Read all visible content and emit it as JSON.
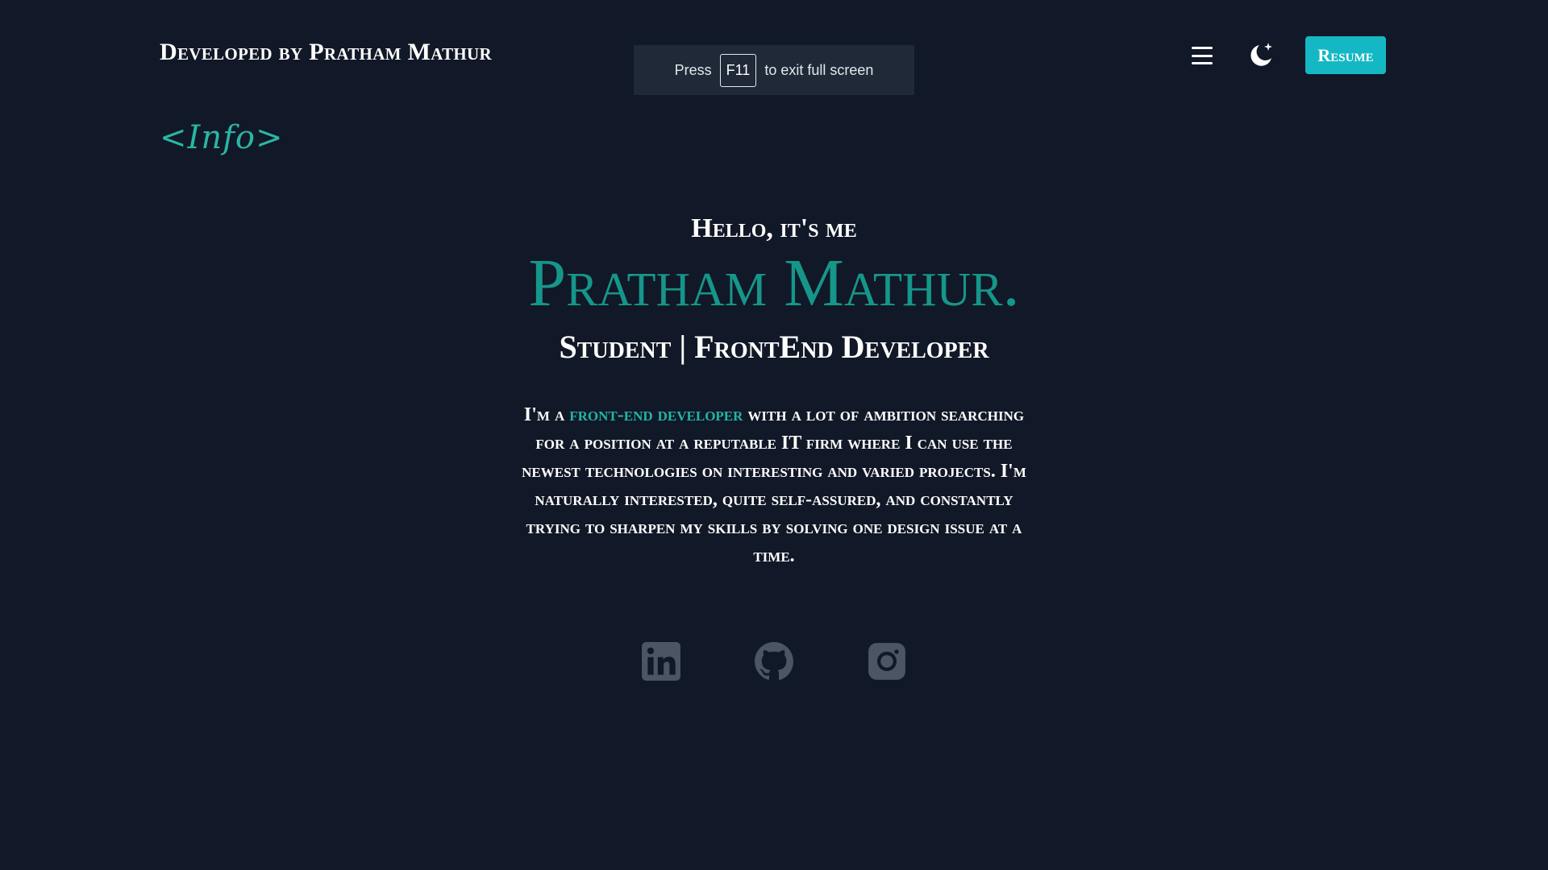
{
  "header": {
    "brand": "Developed by Pratham Mathur",
    "resume_label": "Resume"
  },
  "fullscreen_toast": {
    "before": "Press",
    "key": "F11",
    "after": "to exit full screen"
  },
  "section": {
    "tag": "<Info>"
  },
  "hero": {
    "greeting": "Hello, it's me",
    "name": "Pratham Mathur.",
    "role": "Student | FrontEnd Developer",
    "bio_prefix": "I'm a",
    "bio_highlight": "front-end developer",
    "bio_rest": "with a lot of ambition searching for a position at a reputable IT firm where I can use the newest technologies on interesting and varied projects. I'm naturally interested, quite self-assured, and constantly trying to sharpen my skills by solving one design issue at a time."
  },
  "socials": {
    "icons": [
      "linkedin-icon",
      "github-icon",
      "instagram-icon"
    ]
  },
  "colors": {
    "background": "#111827",
    "accent": "#16968a",
    "highlight": "#22b5a6",
    "button": "#14b8c4",
    "social_icon": "#4b5563"
  }
}
